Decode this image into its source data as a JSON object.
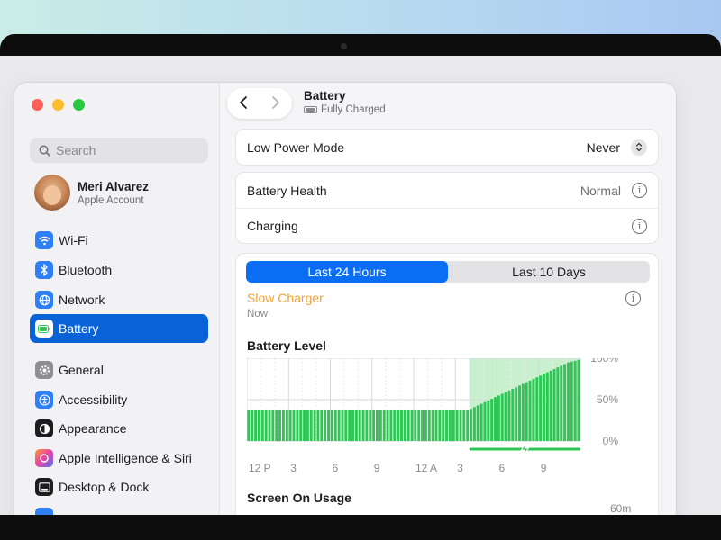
{
  "sidebar": {
    "search_placeholder": "Search",
    "account": {
      "name": "Meri Alvarez",
      "subtitle": "Apple Account"
    },
    "items": [
      {
        "label": "Wi-Fi",
        "icon": "wifi-icon"
      },
      {
        "label": "Bluetooth",
        "icon": "bluetooth-icon"
      },
      {
        "label": "Network",
        "icon": "network-icon"
      },
      {
        "label": "Battery",
        "icon": "battery-icon",
        "active": true
      },
      {
        "label": "General",
        "icon": "gear-icon"
      },
      {
        "label": "Accessibility",
        "icon": "accessibility-icon"
      },
      {
        "label": "Appearance",
        "icon": "appearance-icon"
      },
      {
        "label": "Apple Intelligence & Siri",
        "icon": "siri-icon"
      },
      {
        "label": "Desktop & Dock",
        "icon": "desktop-dock-icon"
      }
    ]
  },
  "header": {
    "title": "Battery",
    "subtitle": "Fully Charged"
  },
  "low_power": {
    "label": "Low Power Mode",
    "value": "Never"
  },
  "health": {
    "label": "Battery Health",
    "value": "Normal"
  },
  "charging": {
    "label": "Charging"
  },
  "tabs": {
    "selected": "Last 24 Hours",
    "other": "Last 10 Days"
  },
  "charger": {
    "title": "Slow Charger",
    "time": "Now"
  },
  "battery_level": {
    "title": "Battery Level"
  },
  "screen_usage": {
    "title": "Screen On Usage",
    "axis_top": "60m"
  },
  "colors": {
    "accent": "#0a6ef5",
    "battery_green": "#2fc655",
    "charging_bg": "#c8f0cf",
    "warning_orange": "#f2a233"
  },
  "chart_data": {
    "type": "bar",
    "title": "Battery Level",
    "x_tick_labels": [
      "12 P",
      "3",
      "6",
      "9",
      "12 A",
      "3",
      "6",
      "9"
    ],
    "y_tick_labels": [
      "100%",
      "50%",
      "0%"
    ],
    "ylim": [
      0,
      100
    ],
    "grid": true,
    "charging_window": {
      "start_hour": 16,
      "end_hour": 24
    },
    "values": [
      37,
      37,
      37,
      37,
      37,
      37,
      37,
      37,
      37,
      37,
      37,
      37,
      37,
      37,
      37,
      37,
      37,
      37,
      37,
      37,
      37,
      37,
      37,
      37,
      37,
      37,
      37,
      37,
      37,
      37,
      37,
      37,
      37,
      37,
      37,
      37,
      37,
      37,
      37,
      37,
      37,
      37,
      37,
      37,
      37,
      37,
      37,
      37,
      37,
      37,
      37,
      37,
      37,
      37,
      37,
      37,
      37,
      37,
      37,
      37,
      37,
      37,
      37,
      37,
      39,
      41,
      43,
      45,
      47,
      49,
      51,
      53,
      55,
      57,
      59,
      61,
      63,
      65,
      67,
      69,
      71,
      73,
      75,
      77,
      79,
      81,
      83,
      85,
      87,
      89,
      91,
      93,
      95,
      96,
      97,
      98
    ]
  }
}
